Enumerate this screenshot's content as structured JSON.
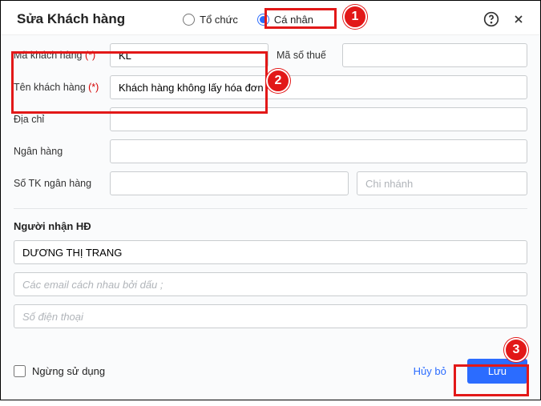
{
  "header": {
    "title": "Sửa Khách hàng",
    "radio_org": "Tổ chức",
    "radio_personal": "Cá nhân"
  },
  "form": {
    "code_label": "Mã khách hàng",
    "code_value": "KL",
    "tax_label": "Mã số thuế",
    "tax_value": "",
    "name_label": "Tên khách hàng",
    "name_value": "Khách hàng không lấy hóa đơn",
    "address_label": "Địa chỉ",
    "address_value": "",
    "bank_label": "Ngân hàng",
    "bank_value": "",
    "bankacct_label": "Số TK ngân hàng",
    "bankacct_value": "",
    "branch_placeholder": "Chi nhánh",
    "required_mark": "(*)"
  },
  "recipient": {
    "section_title": "Người nhận HĐ",
    "name_value": "DƯƠNG THỊ TRANG",
    "email_placeholder": "Các email cách nhau bởi dấu ;",
    "phone_placeholder": "Số điện thoại"
  },
  "footer": {
    "stop_label": "Ngừng sử dụng",
    "cancel": "Hủy bỏ",
    "save": "Lưu"
  },
  "annotations": {
    "m1": "1",
    "m2": "2",
    "m3": "3"
  }
}
